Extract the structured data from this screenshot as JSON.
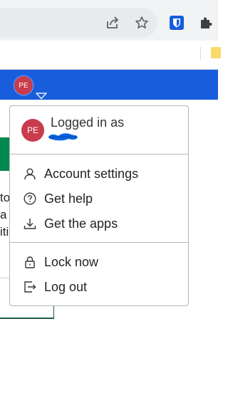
{
  "browser": {
    "share_icon": "share-icon",
    "bookmark_icon": "star-icon",
    "extension_bitwarden": "bitwarden-icon",
    "extensions_icon": "puzzle-icon",
    "bookmark_folder_icon": "folder-icon"
  },
  "header": {
    "avatar_initials": "PE",
    "dropdown_icon": "caret-down-icon",
    "background_color": "#175ddc"
  },
  "background_page": {
    "text_lines": [
      "to",
      "a",
      "iti"
    ]
  },
  "account_menu": {
    "avatar_initials": "PE",
    "logged_in_label": "Logged in as",
    "items": [
      {
        "label": "Account settings",
        "icon": "user-icon"
      },
      {
        "label": "Get help",
        "icon": "help-icon"
      },
      {
        "label": "Get the apps",
        "icon": "download-icon"
      }
    ],
    "secondary_items": [
      {
        "label": "Lock now",
        "icon": "lock-icon"
      },
      {
        "label": "Log out",
        "icon": "logout-icon"
      }
    ]
  },
  "colors": {
    "brand_blue": "#175ddc",
    "avatar_red": "#c83c4c",
    "success_green": "#018850"
  }
}
